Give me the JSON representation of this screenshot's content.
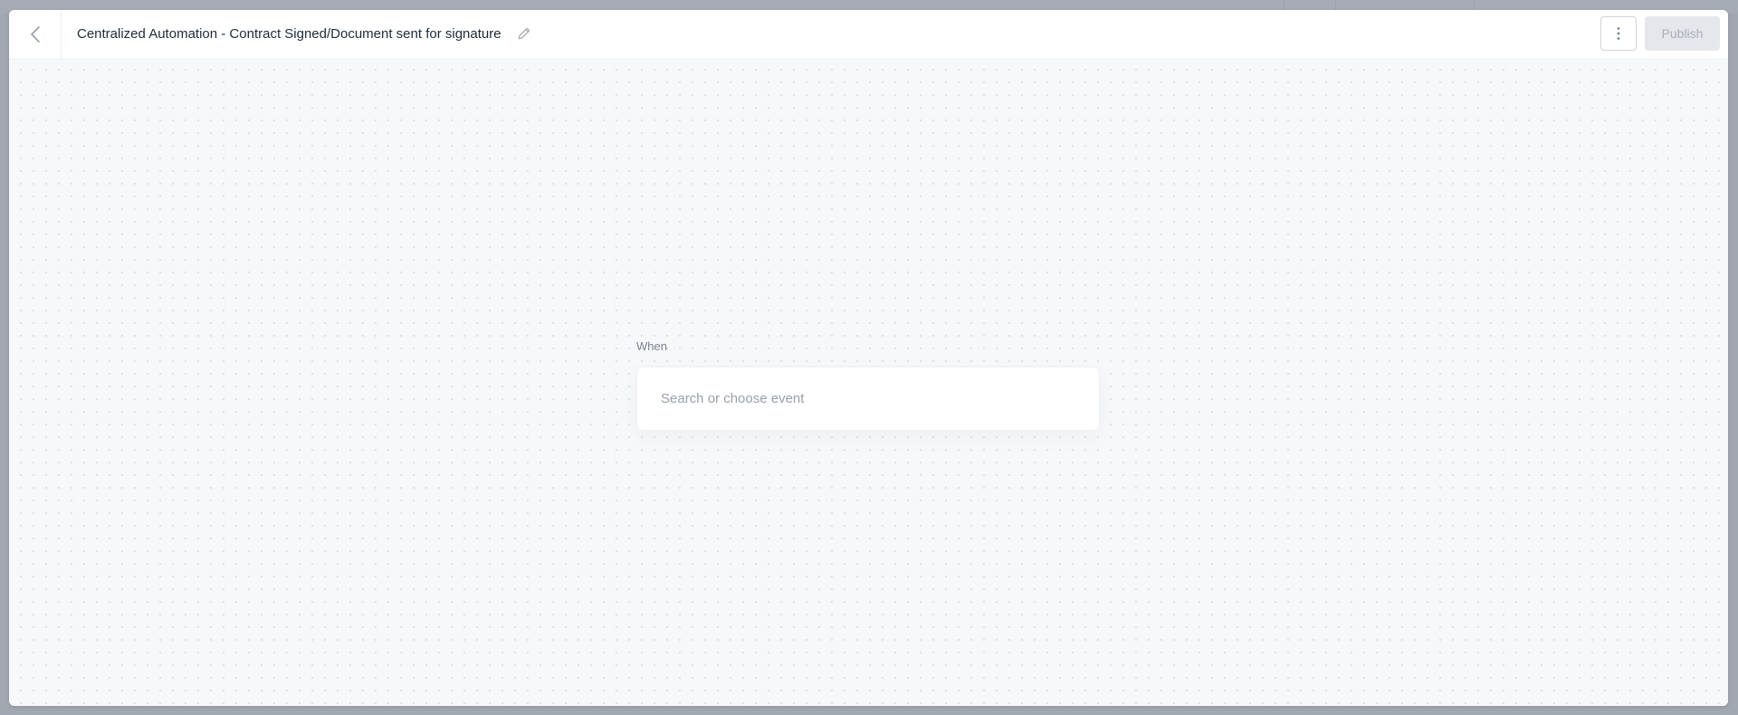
{
  "header": {
    "title": "Centralized Automation - Contract Signed/Document sent for signature",
    "publish_label": "Publish",
    "icons": {
      "back": "chevron-left-icon",
      "edit": "pencil-icon",
      "more": "more-vertical-icon"
    }
  },
  "trigger": {
    "label": "When",
    "event_value": "",
    "event_placeholder": "Search or choose event"
  },
  "colors": {
    "publish_bg_disabled": "#e5e7eb",
    "publish_text_disabled": "#a9afb9",
    "canvas_bg": "#f7f8fa",
    "overlay_bg": "#a2a8b1",
    "title_text": "#1f2a37"
  }
}
